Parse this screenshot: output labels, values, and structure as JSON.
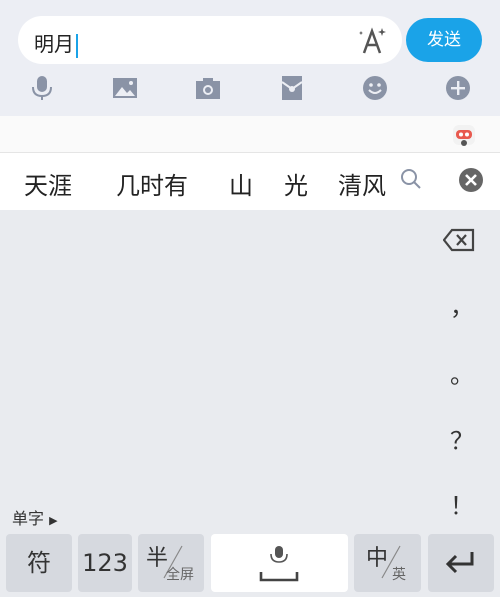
{
  "input": {
    "text": "明月"
  },
  "toolbar": {
    "send_label": "发送"
  },
  "candidates": [
    "天涯",
    "几时有",
    "山",
    "光",
    "清风"
  ],
  "punctuation": [
    "，",
    "。",
    "？",
    "！"
  ],
  "keyboard": {
    "single_char_label": "单字",
    "symbol_key": "符",
    "number_key": "123",
    "half_key_main": "半",
    "half_key_sub": "全屏",
    "lang_key_main": "中",
    "lang_key_sub": "英"
  },
  "colors": {
    "accent": "#1aa3e8",
    "toolbar_icon": "#8a93a6"
  }
}
